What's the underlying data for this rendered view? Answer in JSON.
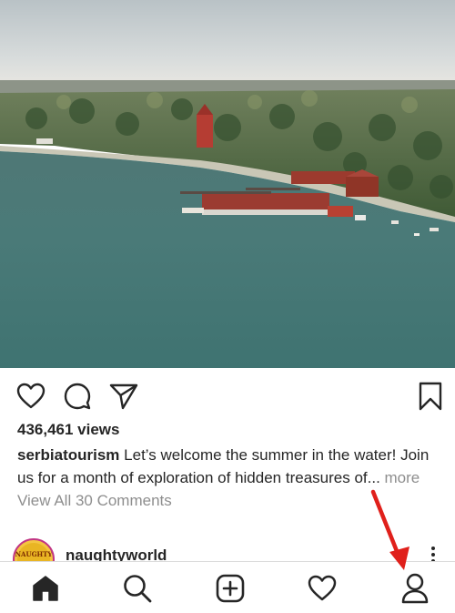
{
  "post": {
    "media_description_icon": "lake-aerial-photo",
    "views": "436,461 views",
    "caption_user": "serbiatourism",
    "caption_text": " Let’s welcome the summer in the water! Join us for a month of exploration of hidden treasures of...",
    "more_label": " more",
    "comments_link": "View All 30 Comments"
  },
  "actions": {
    "like_icon": "heart-outline-icon",
    "comment_icon": "comment-bubble-icon",
    "share_icon": "paper-plane-icon",
    "save_icon": "bookmark-icon"
  },
  "next_post": {
    "username": "naughtyworld",
    "avatar_text": "NAUGHTY",
    "options_icon": "more-vertical-icon"
  },
  "bottom_nav": {
    "items": [
      "home-icon",
      "search-icon",
      "new-post-icon",
      "activity-heart-icon",
      "profile-icon"
    ],
    "active": "home-icon"
  },
  "colors": {
    "text_primary": "#262626",
    "text_secondary": "#8e8e8e",
    "annotation_red": "#e0201b",
    "avatar_ring": "#c13584"
  }
}
